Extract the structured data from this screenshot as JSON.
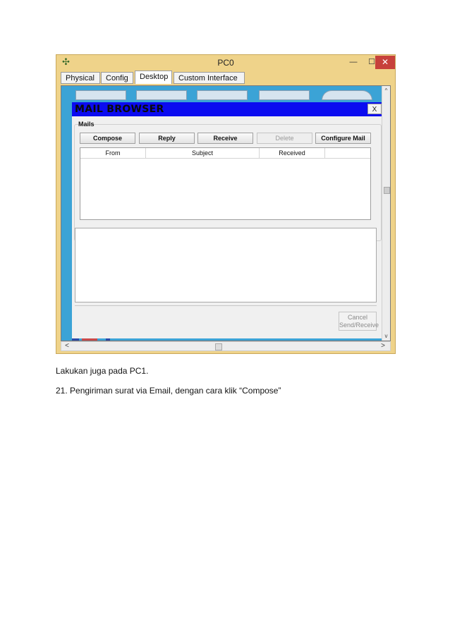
{
  "window": {
    "title": "PC0",
    "controls": {
      "minimize": "—",
      "maximize": "☐",
      "close": "✕"
    }
  },
  "tabs": [
    {
      "label": "Physical",
      "active": false
    },
    {
      "label": "Config",
      "active": false
    },
    {
      "label": "Desktop",
      "active": true
    },
    {
      "label": "Custom Interface",
      "active": false
    }
  ],
  "mail_browser": {
    "title": "MAIL BROWSER",
    "close_label": "X",
    "mails_label": "Mails",
    "buttons": {
      "compose": "Compose",
      "reply": "Reply",
      "receive": "Receive",
      "delete": "Delete",
      "configure": "Configure Mail"
    },
    "columns": [
      "From",
      "Subject",
      "Received"
    ],
    "rows": [],
    "cancel_line1": "Cancel",
    "cancel_line2": "Send/Receive"
  },
  "scroll": {
    "up": "^",
    "down": "v",
    "left": "<",
    "right": ">"
  },
  "captions": {
    "line1": "Lakukan juga pada PC1.",
    "line2": "21. Pengiriman surat via Email, dengan cara klik “Compose”"
  },
  "colors": {
    "frame": "#efd38a",
    "desktop_bg": "#3ba3d6",
    "mail_header": "#0b0bf0",
    "close_red": "#c7413b"
  }
}
